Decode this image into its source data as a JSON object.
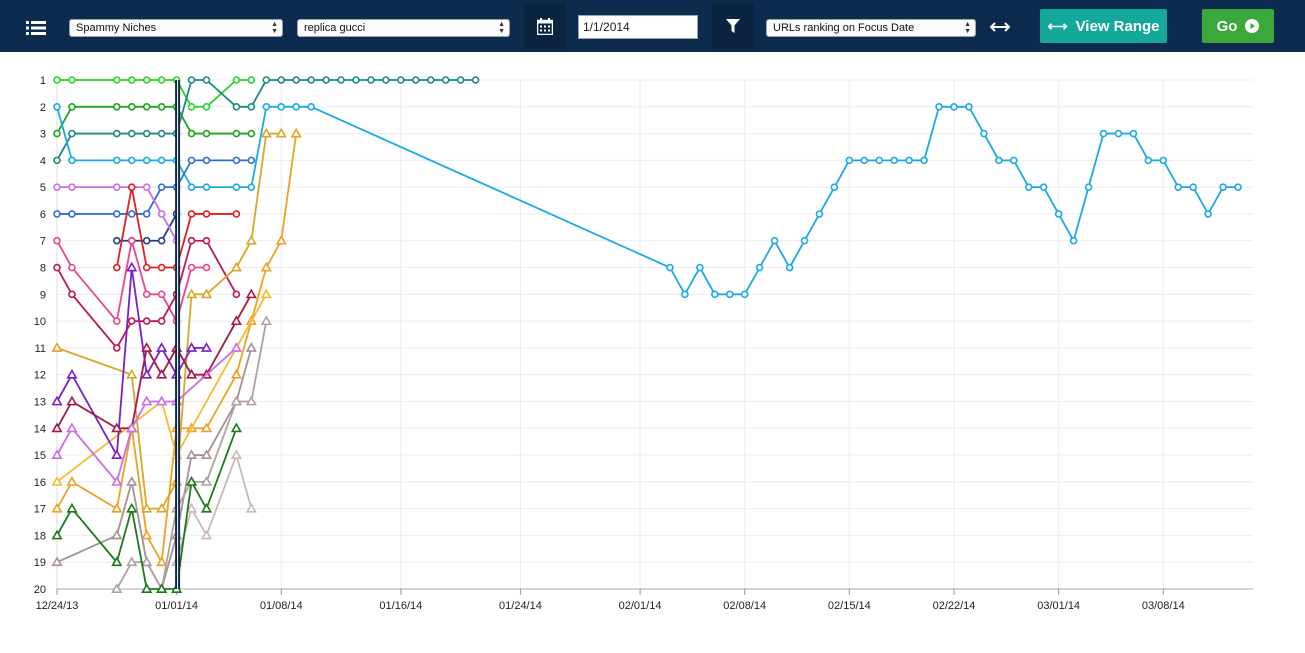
{
  "toolbar": {
    "niche_select": "Spammy Niches",
    "keyword_select": "replica gucci",
    "focus_date": "1/1/2014",
    "mode_select": "URLs ranking on Focus Date",
    "view_range_label": "View Range",
    "go_label": "Go",
    "icons": [
      "menu-icon",
      "calendar-icon",
      "filter-icon",
      "swap-arrows-icon",
      "play-circle-icon"
    ]
  },
  "colors": {
    "toolbar_bg": "#0d2b4e",
    "view_range_bg": "#14a89a",
    "go_bg": "#3ca83a",
    "focus_line": "#0f2a47"
  },
  "chart_data": {
    "type": "line",
    "x_axis": "date",
    "y_axis_inverted": true,
    "ylim": [
      1,
      20
    ],
    "y_ticks": [
      1,
      2,
      3,
      4,
      5,
      6,
      7,
      8,
      9,
      10,
      11,
      12,
      13,
      14,
      15,
      16,
      17,
      18,
      19,
      20
    ],
    "xlim": [
      "12/24/13",
      "03/14/14"
    ],
    "x_ticks": [
      "12/24/13",
      "01/01/14",
      "01/08/14",
      "01/16/14",
      "01/24/14",
      "02/01/14",
      "02/08/14",
      "02/15/14",
      "02/22/14",
      "03/01/14",
      "03/08/14"
    ],
    "focus_date": "01/01/14",
    "grid": true,
    "series": [
      {
        "color": "#27d327",
        "marker": "circle",
        "points": [
          [
            "2013-12-24",
            1
          ],
          [
            "2013-12-25",
            1
          ],
          [
            "2013-12-28",
            1
          ],
          [
            "2013-12-29",
            1
          ],
          [
            "2013-12-30",
            1
          ],
          [
            "2013-12-31",
            1
          ],
          [
            "2014-01-01",
            1
          ],
          [
            "2014-01-02",
            2
          ],
          [
            "2014-01-03",
            2
          ],
          [
            "2014-01-05",
            1
          ],
          [
            "2014-01-06",
            1
          ]
        ]
      },
      {
        "color": "#1ea51e",
        "marker": "circle",
        "points": [
          [
            "2013-12-24",
            3
          ],
          [
            "2013-12-25",
            2
          ],
          [
            "2013-12-28",
            2
          ],
          [
            "2013-12-29",
            2
          ],
          [
            "2013-12-30",
            2
          ],
          [
            "2013-12-31",
            2
          ],
          [
            "2014-01-01",
            2
          ],
          [
            "2014-01-02",
            3
          ],
          [
            "2014-01-03",
            3
          ],
          [
            "2014-01-05",
            3
          ],
          [
            "2014-01-06",
            3
          ]
        ]
      },
      {
        "color": "#1a8a80",
        "marker": "circle",
        "points": [
          [
            "2013-12-24",
            4
          ],
          [
            "2013-12-25",
            3
          ],
          [
            "2013-12-28",
            3
          ],
          [
            "2013-12-29",
            3
          ],
          [
            "2013-12-30",
            3
          ],
          [
            "2013-12-31",
            3
          ],
          [
            "2014-01-01",
            3
          ],
          [
            "2014-01-02",
            1
          ],
          [
            "2014-01-03",
            1
          ],
          [
            "2014-01-05",
            2
          ],
          [
            "2014-01-06",
            2
          ],
          [
            "2014-01-07",
            1
          ],
          [
            "2014-01-08",
            1
          ],
          [
            "2014-01-09",
            1
          ],
          [
            "2014-01-10",
            1
          ],
          [
            "2014-01-11",
            1
          ],
          [
            "2014-01-12",
            1
          ],
          [
            "2014-01-13",
            1
          ],
          [
            "2014-01-14",
            1
          ],
          [
            "2014-01-15",
            1
          ],
          [
            "2014-01-16",
            1
          ],
          [
            "2014-01-17",
            1
          ],
          [
            "2014-01-18",
            1
          ],
          [
            "2014-01-19",
            1
          ],
          [
            "2014-01-20",
            1
          ],
          [
            "2014-01-21",
            1
          ]
        ]
      },
      {
        "color": "#1aa9e8",
        "marker": "circle",
        "points": [
          [
            "2013-12-24",
            2
          ],
          [
            "2013-12-25",
            4
          ],
          [
            "2013-12-28",
            4
          ],
          [
            "2013-12-29",
            4
          ],
          [
            "2013-12-30",
            4
          ],
          [
            "2013-12-31",
            4
          ],
          [
            "2014-01-01",
            4
          ],
          [
            "2014-01-02",
            5
          ],
          [
            "2014-01-03",
            5
          ],
          [
            "2014-01-05",
            5
          ],
          [
            "2014-01-06",
            5
          ],
          [
            "2014-01-07",
            2
          ],
          [
            "2014-01-08",
            2
          ],
          [
            "2014-01-09",
            2
          ],
          [
            "2014-01-10",
            2
          ],
          [
            "2014-02-03",
            8
          ],
          [
            "2014-02-04",
            9
          ],
          [
            "2014-02-05",
            8
          ],
          [
            "2014-02-06",
            9
          ],
          [
            "2014-02-07",
            9
          ],
          [
            "2014-02-08",
            9
          ],
          [
            "2014-02-09",
            8
          ],
          [
            "2014-02-10",
            7
          ],
          [
            "2014-02-11",
            8
          ],
          [
            "2014-02-12",
            7
          ],
          [
            "2014-02-13",
            6
          ],
          [
            "2014-02-14",
            5
          ],
          [
            "2014-02-15",
            4
          ],
          [
            "2014-02-16",
            4
          ],
          [
            "2014-02-17",
            4
          ],
          [
            "2014-02-18",
            4
          ],
          [
            "2014-02-19",
            4
          ],
          [
            "2014-02-20",
            4
          ],
          [
            "2014-02-21",
            2
          ],
          [
            "2014-02-22",
            2
          ],
          [
            "2014-02-23",
            2
          ],
          [
            "2014-02-24",
            3
          ],
          [
            "2014-02-25",
            4
          ],
          [
            "2014-02-26",
            4
          ],
          [
            "2014-02-27",
            5
          ],
          [
            "2014-02-28",
            5
          ],
          [
            "2014-03-01",
            6
          ],
          [
            "2014-03-02",
            7
          ],
          [
            "2014-03-03",
            5
          ],
          [
            "2014-03-04",
            3
          ],
          [
            "2014-03-05",
            3
          ],
          [
            "2014-03-06",
            3
          ],
          [
            "2014-03-07",
            4
          ],
          [
            "2014-03-08",
            4
          ],
          [
            "2014-03-09",
            5
          ],
          [
            "2014-03-10",
            5
          ],
          [
            "2014-03-11",
            6
          ],
          [
            "2014-03-12",
            5
          ],
          [
            "2014-03-13",
            5
          ]
        ]
      },
      {
        "color": "#2e6fd1",
        "marker": "circle",
        "points": [
          [
            "2013-12-24",
            6
          ],
          [
            "2013-12-25",
            6
          ],
          [
            "2013-12-28",
            6
          ],
          [
            "2013-12-29",
            6
          ],
          [
            "2013-12-30",
            6
          ],
          [
            "2013-12-31",
            5
          ],
          [
            "2014-01-01",
            5
          ],
          [
            "2014-01-02",
            4
          ],
          [
            "2014-01-03",
            4
          ],
          [
            "2014-01-05",
            4
          ],
          [
            "2014-01-06",
            4
          ]
        ]
      },
      {
        "color": "#1f3f8a",
        "marker": "circle",
        "points": [
          [
            "2013-12-28",
            7
          ],
          [
            "2013-12-29",
            7
          ],
          [
            "2013-12-30",
            7
          ],
          [
            "2013-12-31",
            7
          ],
          [
            "2014-01-01",
            6
          ]
        ]
      },
      {
        "color": "#c86ee8",
        "marker": "circle",
        "points": [
          [
            "2013-12-24",
            5
          ],
          [
            "2013-12-25",
            5
          ],
          [
            "2013-12-28",
            5
          ],
          [
            "2013-12-29",
            5
          ],
          [
            "2013-12-30",
            5
          ],
          [
            "2013-12-31",
            6
          ],
          [
            "2014-01-01",
            7
          ]
        ]
      },
      {
        "color": "#e01f1f",
        "marker": "circle",
        "points": [
          [
            "2013-12-28",
            8
          ],
          [
            "2013-12-29",
            5
          ],
          [
            "2013-12-30",
            8
          ],
          [
            "2013-12-31",
            8
          ],
          [
            "2014-01-01",
            8
          ],
          [
            "2014-01-02",
            6
          ],
          [
            "2014-01-03",
            6
          ],
          [
            "2014-01-05",
            6
          ]
        ]
      },
      {
        "color": "#e8458a",
        "marker": "circle",
        "points": [
          [
            "2013-12-24",
            7
          ],
          [
            "2013-12-25",
            8
          ],
          [
            "2013-12-28",
            10
          ],
          [
            "2013-12-29",
            7
          ],
          [
            "2013-12-30",
            9
          ],
          [
            "2013-12-31",
            9
          ],
          [
            "2014-01-01",
            10
          ],
          [
            "2014-01-02",
            8
          ],
          [
            "2014-01-03",
            8
          ]
        ]
      },
      {
        "color": "#c0184e",
        "marker": "circle",
        "points": [
          [
            "2013-12-24",
            8
          ],
          [
            "2013-12-25",
            9
          ],
          [
            "2013-12-28",
            11
          ],
          [
            "2013-12-29",
            10
          ],
          [
            "2013-12-30",
            10
          ],
          [
            "2013-12-31",
            10
          ],
          [
            "2014-01-01",
            9
          ],
          [
            "2014-01-02",
            7
          ],
          [
            "2014-01-03",
            7
          ],
          [
            "2014-01-05",
            9
          ]
        ]
      },
      {
        "color": "#d9a62a",
        "marker": "triangle",
        "points": [
          [
            "2013-12-24",
            11
          ],
          [
            "2013-12-29",
            12
          ],
          [
            "2013-12-30",
            17
          ],
          [
            "2013-12-31",
            17
          ],
          [
            "2014-01-01",
            16
          ],
          [
            "2014-01-02",
            9
          ],
          [
            "2014-01-03",
            9
          ],
          [
            "2014-01-05",
            8
          ],
          [
            "2014-01-06",
            7
          ],
          [
            "2014-01-07",
            3
          ],
          [
            "2014-01-08",
            3
          ]
        ]
      },
      {
        "color": "#f0a020",
        "marker": "triangle",
        "points": [
          [
            "2013-12-24",
            17
          ],
          [
            "2013-12-25",
            16
          ],
          [
            "2013-12-28",
            17
          ],
          [
            "2013-12-29",
            14
          ],
          [
            "2013-12-30",
            18
          ],
          [
            "2013-12-31",
            19
          ],
          [
            "2014-01-01",
            14
          ],
          [
            "2014-01-02",
            14
          ],
          [
            "2014-01-03",
            14
          ],
          [
            "2014-01-05",
            12
          ],
          [
            "2014-01-06",
            10
          ],
          [
            "2014-01-07",
            8
          ],
          [
            "2014-01-08",
            7
          ],
          [
            "2014-01-09",
            3
          ]
        ]
      },
      {
        "color": "#f7b92f",
        "marker": "triangle",
        "points": [
          [
            "2013-12-24",
            16
          ],
          [
            "2013-12-31",
            13
          ],
          [
            "2014-01-01",
            15
          ],
          [
            "2014-01-05",
            11
          ],
          [
            "2014-01-07",
            9
          ]
        ]
      },
      {
        "color": "#7a1fc7",
        "marker": "triangle",
        "points": [
          [
            "2013-12-24",
            13
          ],
          [
            "2013-12-25",
            12
          ],
          [
            "2013-12-28",
            15
          ],
          [
            "2013-12-29",
            8
          ],
          [
            "2013-12-30",
            12
          ],
          [
            "2013-12-31",
            11
          ],
          [
            "2014-01-01",
            12
          ],
          [
            "2014-01-02",
            11
          ],
          [
            "2014-01-03",
            11
          ]
        ]
      },
      {
        "color": "#a31845",
        "marker": "triangle",
        "points": [
          [
            "2013-12-24",
            14
          ],
          [
            "2013-12-25",
            13
          ],
          [
            "2013-12-28",
            14
          ],
          [
            "2013-12-29",
            14
          ],
          [
            "2013-12-30",
            11
          ],
          [
            "2013-12-31",
            12
          ],
          [
            "2014-01-01",
            11
          ],
          [
            "2014-01-02",
            12
          ],
          [
            "2014-01-03",
            12
          ],
          [
            "2014-01-05",
            10
          ],
          [
            "2014-01-06",
            9
          ]
        ]
      },
      {
        "color": "#c86ee8",
        "marker": "triangle",
        "points": [
          [
            "2013-12-24",
            15
          ],
          [
            "2013-12-25",
            14
          ],
          [
            "2013-12-28",
            16
          ],
          [
            "2013-12-29",
            14
          ],
          [
            "2013-12-30",
            13
          ],
          [
            "2013-12-31",
            13
          ],
          [
            "2014-01-01",
            13
          ],
          [
            "2014-01-05",
            11
          ]
        ]
      },
      {
        "color": "#a89090",
        "marker": "triangle",
        "points": [
          [
            "2013-12-24",
            19
          ],
          [
            "2013-12-28",
            18
          ],
          [
            "2013-12-29",
            16
          ],
          [
            "2013-12-30",
            19
          ],
          [
            "2013-12-31",
            20
          ],
          [
            "2014-01-01",
            18
          ],
          [
            "2014-01-02",
            15
          ],
          [
            "2014-01-03",
            15
          ],
          [
            "2014-01-05",
            13
          ],
          [
            "2014-01-06",
            11
          ]
        ]
      },
      {
        "color": "#b0a0a0",
        "marker": "triangle",
        "points": [
          [
            "2013-12-28",
            20
          ],
          [
            "2013-12-29",
            19
          ],
          [
            "2013-12-30",
            19
          ],
          [
            "2013-12-31",
            20
          ],
          [
            "2014-01-01",
            17
          ],
          [
            "2014-01-02",
            16
          ],
          [
            "2014-01-03",
            16
          ],
          [
            "2014-01-05",
            13
          ],
          [
            "2014-01-06",
            13
          ],
          [
            "2014-01-07",
            10
          ]
        ]
      },
      {
        "color": "#c8b8b8",
        "marker": "triangle",
        "points": [
          [
            "2014-01-01",
            19
          ],
          [
            "2014-01-02",
            17
          ],
          [
            "2014-01-03",
            18
          ],
          [
            "2014-01-05",
            15
          ],
          [
            "2014-01-06",
            17
          ]
        ]
      },
      {
        "color": "#1a7a1a",
        "marker": "triangle",
        "points": [
          [
            "2013-12-24",
            18
          ],
          [
            "2013-12-25",
            17
          ],
          [
            "2013-12-28",
            19
          ],
          [
            "2013-12-29",
            17
          ],
          [
            "2013-12-30",
            20
          ],
          [
            "2013-12-31",
            20
          ],
          [
            "2014-01-01",
            20
          ],
          [
            "2014-01-02",
            16
          ],
          [
            "2014-01-03",
            17
          ],
          [
            "2014-01-05",
            14
          ]
        ]
      }
    ]
  }
}
